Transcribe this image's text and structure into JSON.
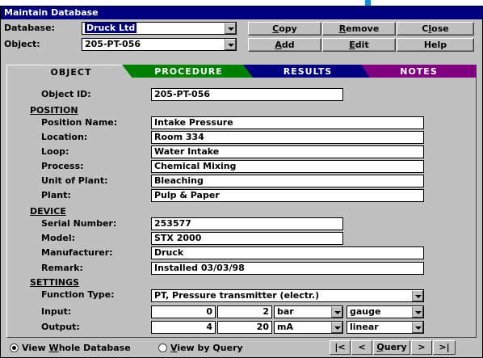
{
  "window": {
    "title": "Maintain Database"
  },
  "toolbar": {
    "database_label": "Database:",
    "database_value": "Druck Ltd",
    "object_label": "Object:",
    "object_value": "205-PT-056",
    "copy": {
      "pre": "",
      "u": "C",
      "post": "opy"
    },
    "remove": {
      "pre": "",
      "u": "R",
      "post": "emove"
    },
    "close": {
      "pre": "C",
      "u": "l",
      "post": "ose"
    },
    "add": {
      "pre": "",
      "u": "A",
      "post": "dd"
    },
    "edit": {
      "pre": "",
      "u": "E",
      "post": "dit"
    },
    "help": "Help"
  },
  "tabs": [
    {
      "label": "OBJECT",
      "color": "#c0c0c0"
    },
    {
      "label": "PROCEDURE",
      "color": "#008000"
    },
    {
      "label": "RESULTS",
      "color": "#000080"
    },
    {
      "label": "NOTES",
      "color": "#800080"
    }
  ],
  "object": {
    "id_label": "Object ID:",
    "id_value": "205-PT-056",
    "position": {
      "heading": "POSITION",
      "name_label": "Position Name:",
      "name_value": "Intake Pressure",
      "location_label": "Location:",
      "location_value": "Room 334",
      "loop_label": "Loop:",
      "loop_value": "Water Intake",
      "process_label": "Process:",
      "process_value": "Chemical Mixing",
      "unit_label": "Unit of Plant:",
      "unit_value": "Bleaching",
      "plant_label": "Plant:",
      "plant_value": "Pulp & Paper"
    },
    "device": {
      "heading": "DEVICE",
      "serial_label": "Serial Number:",
      "serial_value": "253577",
      "model_label": "Model:",
      "model_value": "STX 2000",
      "manufacturer_label": "Manufacturer:",
      "manufacturer_value": "Druck",
      "remark_label": "Remark:",
      "remark_value": "Installed 03/03/98"
    },
    "settings": {
      "heading": "SETTINGS",
      "function_label": "Function Type:",
      "function_value": "PT, Pressure transmitter (electr.)",
      "input_label": "Input:",
      "input_min": "0",
      "input_max": "2",
      "input_unit": "bar",
      "input_mode": "gauge",
      "output_label": "Output:",
      "output_min": "4",
      "output_max": "20",
      "output_unit": "mA",
      "output_mode": "linear"
    }
  },
  "footer": {
    "view_whole": {
      "pre": "View ",
      "u": "W",
      "post": "hole Database"
    },
    "view_query": {
      "pre": "",
      "u": "V",
      "post": "iew by Query"
    },
    "nav_first": "|<",
    "nav_prev": "<",
    "query": {
      "pre": "",
      "u": "Q",
      "post": "uery"
    },
    "nav_next": ">",
    "nav_last": ">|"
  }
}
